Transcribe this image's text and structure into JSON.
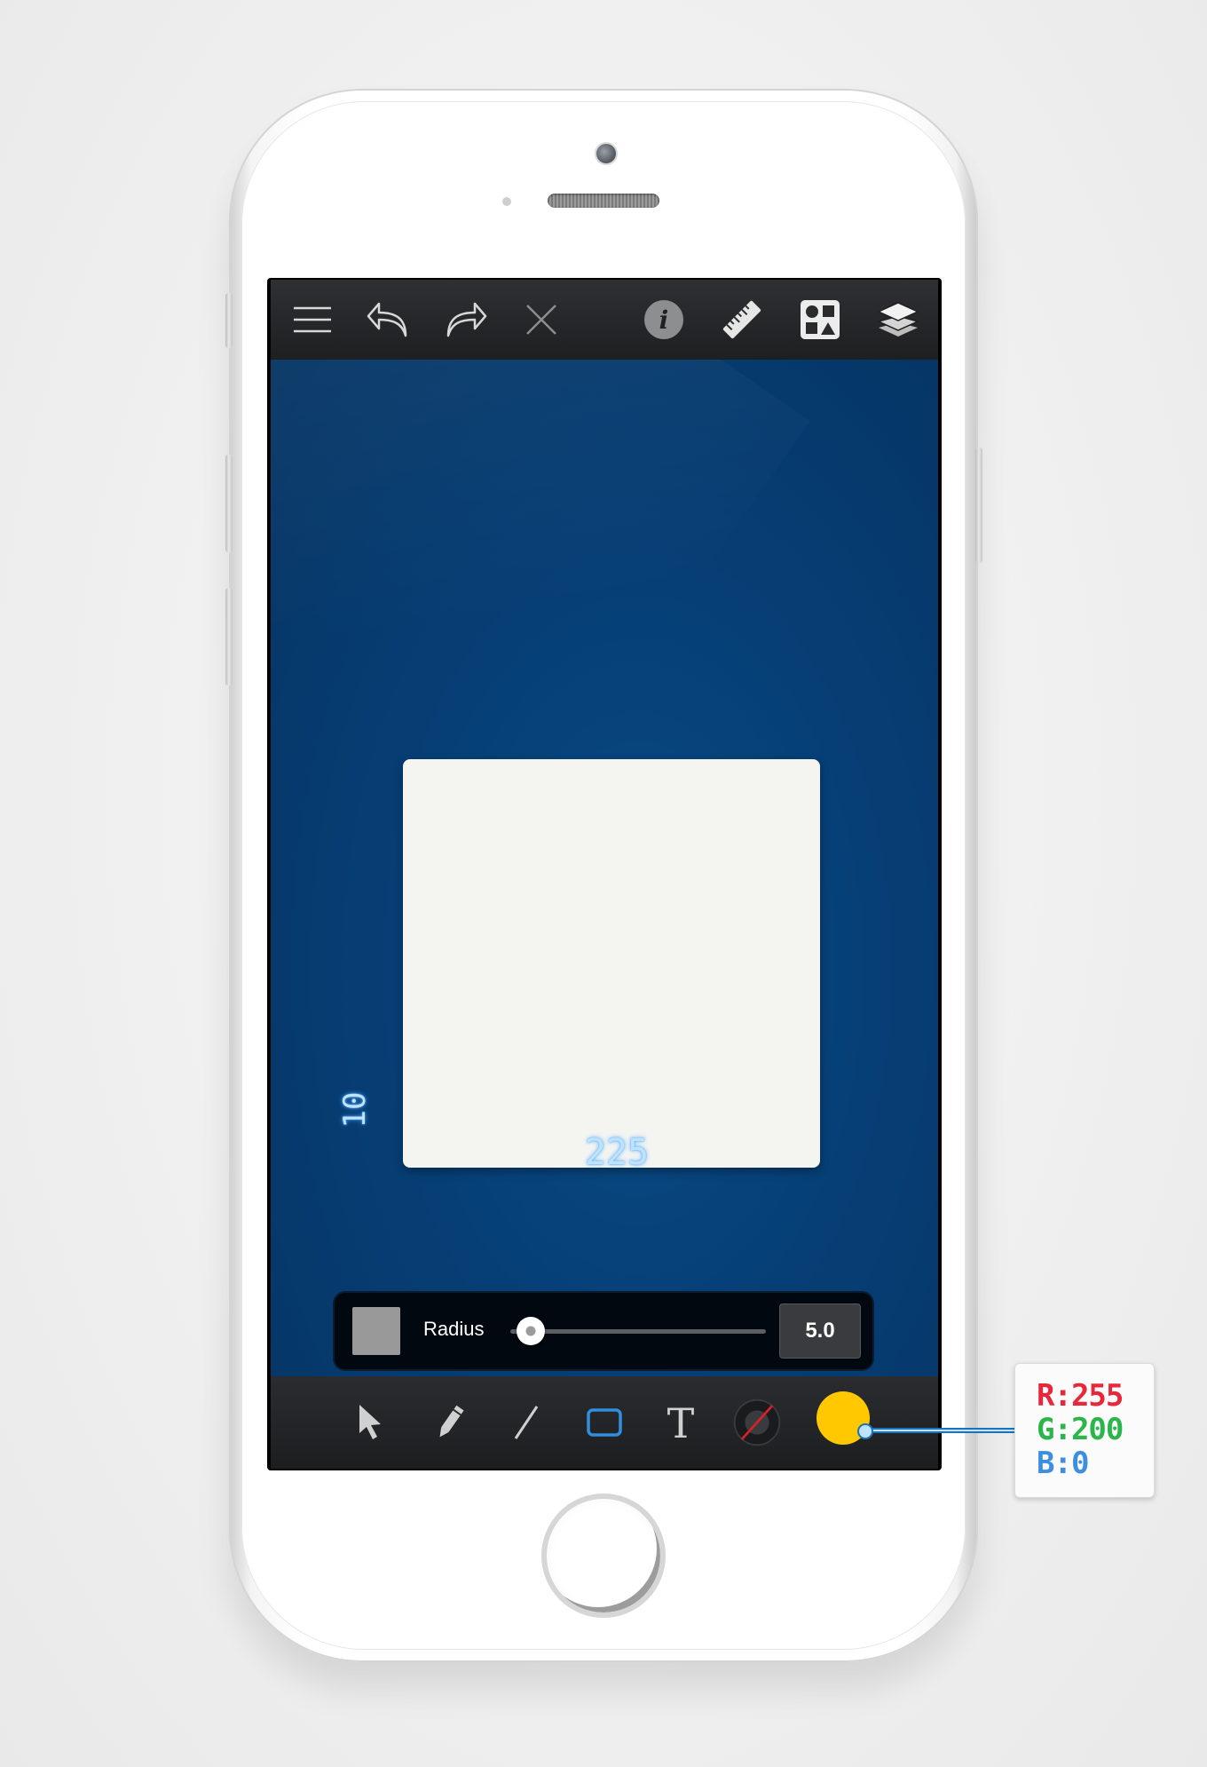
{
  "toolbar_top": {
    "icons": [
      "menu-icon",
      "undo-icon",
      "redo-icon",
      "close-icon",
      "info-icon",
      "ruler-icon",
      "shapes-icon",
      "layers-icon"
    ]
  },
  "canvas": {
    "width_value": "225",
    "height_value": "10",
    "shape_fill": "#f4f5f1",
    "shape_shadow": "#e3ad10",
    "background": "#063f76"
  },
  "radius_panel": {
    "label": "Radius",
    "value": "5.0",
    "slider_fraction": 0.08,
    "swatch_color": "#999999"
  },
  "tools": [
    "select-tool",
    "pencil-tool",
    "line-tool",
    "rectangle-tool",
    "text-tool",
    "stroke-tool",
    "fill-color"
  ],
  "fill_color": "#FFC800",
  "rgb": {
    "r_label": "R:255",
    "g_label": "G:200",
    "b_label": "B:0",
    "r_color": "#e8283a",
    "g_color": "#2bb54a",
    "b_color": "#3b8ee0"
  }
}
